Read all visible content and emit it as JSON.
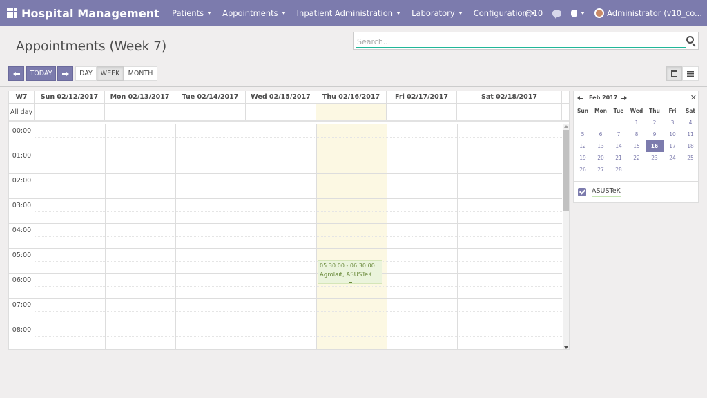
{
  "navbar": {
    "brand": "Hospital Management",
    "menu": [
      "Patients",
      "Appointments",
      "Inpatient Administration",
      "Laboratory",
      "Configuration"
    ],
    "mentions": "@10",
    "user": "Administrator (v10_co..."
  },
  "page": {
    "title": "Appointments (Week 7)",
    "search_placeholder": "Search..."
  },
  "toolbar": {
    "today": "TODAY",
    "views": [
      "DAY",
      "WEEK",
      "MONTH"
    ],
    "active_view": "WEEK"
  },
  "calendar": {
    "week_label": "W7",
    "days": [
      "Sun 02/12/2017",
      "Mon 02/13/2017",
      "Tue 02/14/2017",
      "Wed 02/15/2017",
      "Thu 02/16/2017",
      "Fri 02/17/2017",
      "Sat 02/18/2017"
    ],
    "today_index": 4,
    "allday_label": "All day",
    "hours": [
      "00:00",
      "01:00",
      "02:00",
      "03:00",
      "04:00",
      "05:00",
      "06:00",
      "07:00",
      "08:00"
    ],
    "event": {
      "time": "05:30:00 - 06:30:00",
      "title": "Agrolait, ASUSTeK",
      "day_index": 4,
      "start_hour": 5.5,
      "end_hour": 6.5
    }
  },
  "mini_calendar": {
    "title": "Feb 2017",
    "dow": [
      "Sun",
      "Mon",
      "Tue",
      "Wed",
      "Thu",
      "Fri",
      "Sat"
    ],
    "weeks": [
      [
        "",
        "",
        "",
        "1",
        "2",
        "3",
        "4"
      ],
      [
        "5",
        "6",
        "7",
        "8",
        "9",
        "10",
        "11"
      ],
      [
        "12",
        "13",
        "14",
        "15",
        "16",
        "17",
        "18"
      ],
      [
        "19",
        "20",
        "21",
        "22",
        "23",
        "24",
        "25"
      ],
      [
        "26",
        "27",
        "28",
        "",
        "",
        "",
        ""
      ]
    ],
    "selected": "16"
  },
  "filters": [
    {
      "label": "ASUSTeK",
      "checked": true
    }
  ],
  "colors": {
    "brand": "#7c7bad",
    "today_bg": "#fcf8e3",
    "event_bg": "#ebf4dc",
    "search_underline": "#21b799"
  }
}
